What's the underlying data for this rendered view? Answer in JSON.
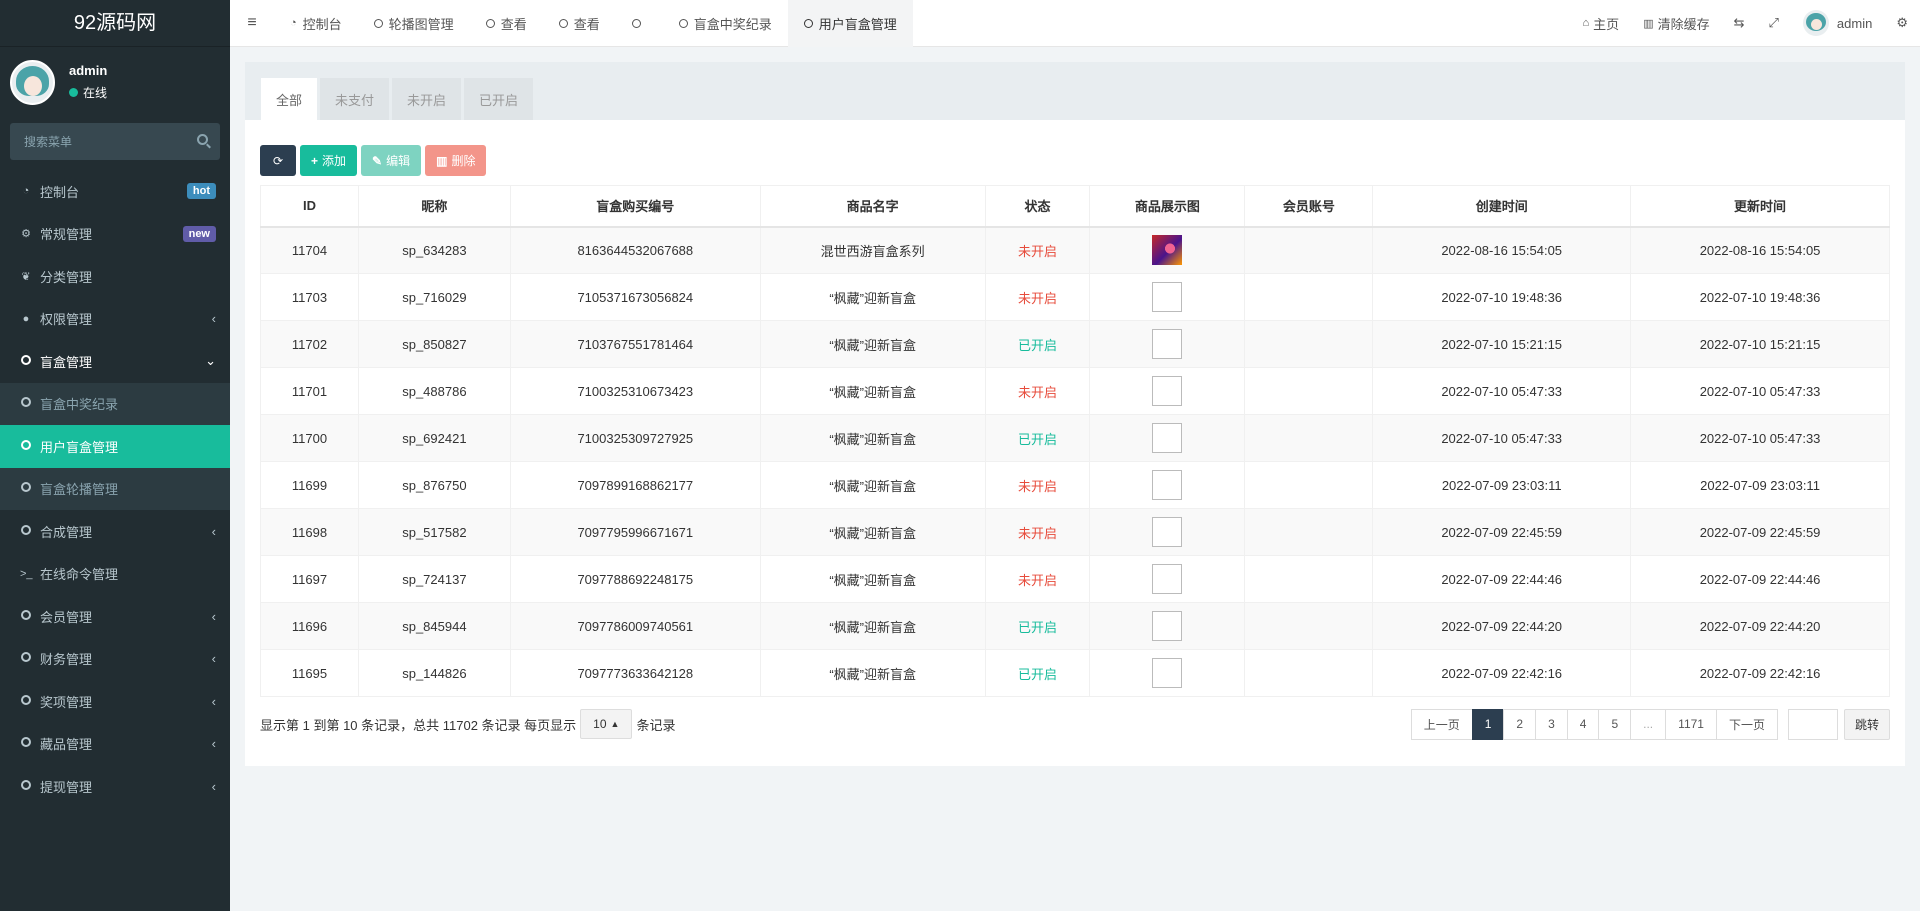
{
  "app": {
    "logo": "92源码网"
  },
  "user": {
    "name": "admin",
    "status": "在线"
  },
  "search": {
    "placeholder": "搜索菜单"
  },
  "sidebar": {
    "items": [
      {
        "label": "控制台",
        "badge": "hot"
      },
      {
        "label": "常规管理",
        "badge": "new"
      },
      {
        "label": "分类管理"
      },
      {
        "label": "权限管理"
      },
      {
        "label": "盲盒管理"
      },
      {
        "label": "盲盒中奖纪录"
      },
      {
        "label": "用户盲盒管理"
      },
      {
        "label": "盲盒轮播管理"
      },
      {
        "label": "合成管理"
      },
      {
        "label": "在线命令管理"
      },
      {
        "label": "会员管理"
      },
      {
        "label": "财务管理"
      },
      {
        "label": "奖项管理"
      },
      {
        "label": "藏品管理"
      },
      {
        "label": "提现管理"
      }
    ]
  },
  "topnav": {
    "tabs": [
      "控制台",
      "轮播图管理",
      "查看",
      "查看",
      "",
      "盲盒中奖纪录",
      "用户盲盒管理"
    ],
    "home": "主页",
    "clear_cache": "清除缓存",
    "user": "admin"
  },
  "panel": {
    "tabs": [
      "全部",
      "未支付",
      "未开启",
      "已开启"
    ]
  },
  "toolbar": {
    "add": "添加",
    "edit": "编辑",
    "delete": "删除"
  },
  "table": {
    "headers": [
      "ID",
      "昵称",
      "盲盒购买编号",
      "商品名字",
      "状态",
      "商品展示图",
      "会员账号",
      "创建时间",
      "更新时间"
    ],
    "rows": [
      [
        "11704",
        "sp_634283",
        "8163644532067688",
        "混世西游盲盒系列",
        "未开启",
        "",
        "",
        "2022-08-16 15:54:05",
        "2022-08-16 15:54:05"
      ],
      [
        "11703",
        "sp_716029",
        "7105371673056824",
        "“枫藏”迎新盲盒",
        "未开启",
        "",
        "",
        "2022-07-10 19:48:36",
        "2022-07-10 19:48:36"
      ],
      [
        "11702",
        "sp_850827",
        "7103767551781464",
        "“枫藏”迎新盲盒",
        "已开启",
        "",
        "",
        "2022-07-10 15:21:15",
        "2022-07-10 15:21:15"
      ],
      [
        "11701",
        "sp_488786",
        "7100325310673423",
        "“枫藏”迎新盲盒",
        "未开启",
        "",
        "",
        "2022-07-10 05:47:33",
        "2022-07-10 05:47:33"
      ],
      [
        "11700",
        "sp_692421",
        "7100325309727925",
        "“枫藏”迎新盲盒",
        "已开启",
        "",
        "",
        "2022-07-10 05:47:33",
        "2022-07-10 05:47:33"
      ],
      [
        "11699",
        "sp_876750",
        "7097899168862177",
        "“枫藏”迎新盲盒",
        "未开启",
        "",
        "",
        "2022-07-09 23:03:11",
        "2022-07-09 23:03:11"
      ],
      [
        "11698",
        "sp_517582",
        "7097795996671671",
        "“枫藏”迎新盲盒",
        "未开启",
        "",
        "",
        "2022-07-09 22:45:59",
        "2022-07-09 22:45:59"
      ],
      [
        "11697",
        "sp_724137",
        "7097788692248175",
        "“枫藏”迎新盲盒",
        "未开启",
        "",
        "",
        "2022-07-09 22:44:46",
        "2022-07-09 22:44:46"
      ],
      [
        "11696",
        "sp_845944",
        "7097786009740561",
        "“枫藏”迎新盲盒",
        "已开启",
        "",
        "",
        "2022-07-09 22:44:20",
        "2022-07-09 22:44:20"
      ],
      [
        "11695",
        "sp_144826",
        "7097773633642128",
        "“枫藏”迎新盲盒",
        "已开启",
        "",
        "",
        "2022-07-09 22:42:16",
        "2022-07-09 22:42:16"
      ]
    ]
  },
  "footer": {
    "summary": "显示第 1 到第 10 条记录，总共 11702 条记录 每页显示",
    "page_size": "10",
    "suffix": "条记录"
  },
  "pagination": {
    "prev": "上一页",
    "pages": [
      "1",
      "2",
      "3",
      "4",
      "5",
      "...",
      "1171"
    ],
    "next": "下一页",
    "go": "跳转"
  },
  "colors": {
    "accent": "#18bc9c",
    "sidebar": "#222d32",
    "dark": "#2c3e50",
    "danger": "#e74c3c"
  }
}
